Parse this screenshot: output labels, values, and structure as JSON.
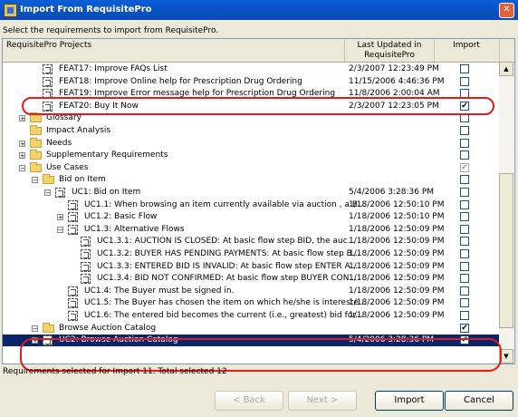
{
  "window": {
    "title": "Import From RequisitePro",
    "close": "✕"
  },
  "instruction": "Select the requirements to import from RequisitePro.",
  "columns": {
    "name": "RequisitePro Projects",
    "updated": "Last Updated in RequisitePro",
    "import": "Import"
  },
  "rows": [
    {
      "label": "FEAT17: Improve FAQs List",
      "date": "2/3/2007 12:23:49 PM",
      "checked": false
    },
    {
      "label": "FEAT18: Improve Online help for Prescription Drug Ordering",
      "date": "11/15/2006 4:46:36 PM",
      "checked": false
    },
    {
      "label": "FEAT19: Improve Error message help for Prescription Drug Ordering",
      "date": "11/8/2006 2:00:04 AM",
      "checked": false
    },
    {
      "label": "FEAT20: Buy It Now",
      "date": "2/3/2007 12:23:05 PM",
      "checked": true
    },
    {
      "label": "Glossary",
      "date": "",
      "checked": false
    },
    {
      "label": "Impact Analysis",
      "date": "",
      "checked": false
    },
    {
      "label": "Needs",
      "date": "",
      "checked": false
    },
    {
      "label": "Supplementary Requirements",
      "date": "",
      "checked": false
    },
    {
      "label": "Use Cases",
      "date": "",
      "checked": true
    },
    {
      "label": "Bid on Item",
      "date": "",
      "checked": false
    },
    {
      "label": "UC1: Bid on Item",
      "date": "5/4/2006 3:28:36 PM",
      "checked": false
    },
    {
      "label": "UC1.1: When browsing an item currently available via auction , a B...",
      "date": "1/18/2006 12:50:10 PM",
      "checked": false
    },
    {
      "label": "UC1.2: Basic Flow",
      "date": "1/18/2006 12:50:10 PM",
      "checked": false
    },
    {
      "label": "UC1.3: Alternative Flows",
      "date": "1/18/2006 12:50:09 PM",
      "checked": false
    },
    {
      "label": "UC1.3.1: AUCTION IS CLOSED:  At basic flow step BID, the auc...",
      "date": "1/18/2006 12:50:09 PM",
      "checked": false
    },
    {
      "label": "UC1.3.2: BUYER HAS PENDING PAYMENTS:  At basic flow step B...",
      "date": "1/18/2006 12:50:09 PM",
      "checked": false
    },
    {
      "label": "UC1.3.3: ENTERED BID IS INVALID:  At basic flow step ENTER A...",
      "date": "1/18/2006 12:50:09 PM",
      "checked": false
    },
    {
      "label": "UC1.3.4: BID NOT CONFIRMED:  At basic flow step BUYER CON...",
      "date": "1/18/2006 12:50:09 PM",
      "checked": false
    },
    {
      "label": "UC1.4: The Buyer must be signed in.",
      "date": "1/18/2006 12:50:09 PM",
      "checked": false
    },
    {
      "label": "UC1.5: The Buyer has chosen the item on which he/she is intereste...",
      "date": "1/18/2006 12:50:09 PM",
      "checked": false
    },
    {
      "label": "UC1.6: The entered bid becomes the current (i.e., greatest) bid for...",
      "date": "1/18/2006 12:50:09 PM",
      "checked": false
    },
    {
      "label": "Browse Auction Catalog",
      "date": "",
      "checked": true
    },
    {
      "label": "UC2: Browse Auction Catalog",
      "date": "5/4/2006 3:28:36 PM",
      "checked": true
    }
  ],
  "status": "Requirements selected for Import 11. Total selected 12",
  "buttons": {
    "back": "< Back",
    "next": "Next >",
    "import": "Import",
    "cancel": "Cancel"
  }
}
